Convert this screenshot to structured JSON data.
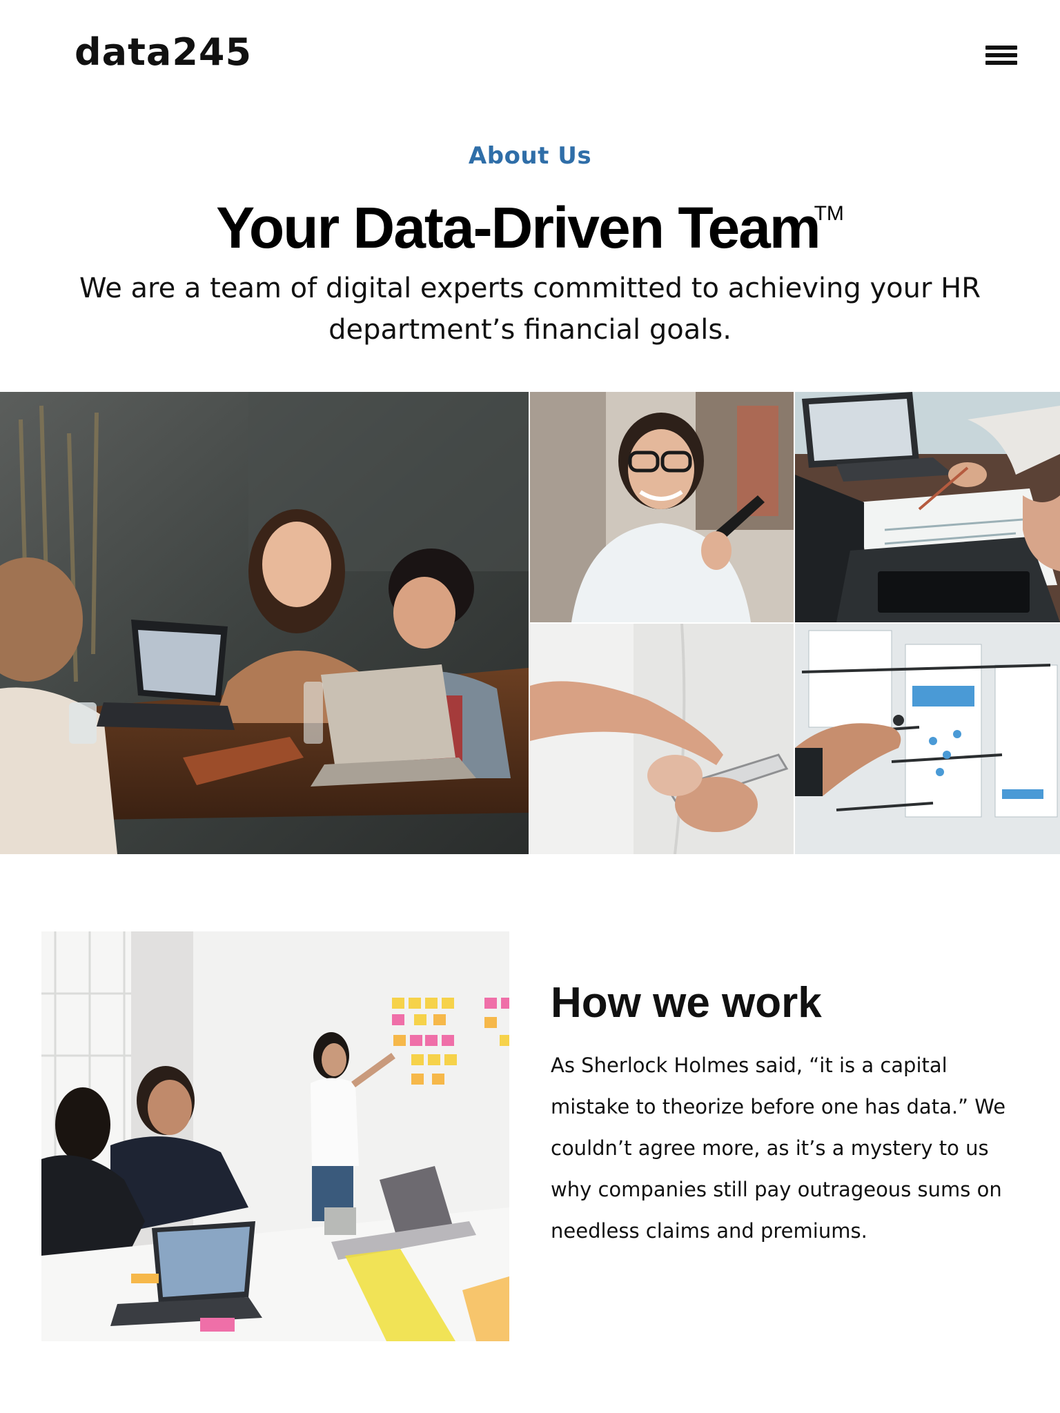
{
  "header": {
    "logo": "data245",
    "menu_icon": "hamburger-menu-icon"
  },
  "hero": {
    "eyebrow": "About Us",
    "headline": "Your Data-Driven Team",
    "trademark": "TM",
    "subtext": "We are a team of digital experts committed to achieving your HR department’s financial goals."
  },
  "gallery": {
    "photos": [
      "team-laughing-photo",
      "woman-with-phone-photo",
      "laptops-notes-photo",
      "finger-on-phone-photo",
      "hand-on-whiteboard-photo"
    ]
  },
  "how_we_work": {
    "title": "How we work",
    "body": "As Sherlock Holmes said, “it is a capital mistake to theorize before one has data.” We couldn’t agree more, as it’s a mystery to us why companies still pay outrageous sums on needless claims and premiums.",
    "photo": "team-meeting-sticky-notes-photo"
  },
  "colors": {
    "accent": "#2f6ea8",
    "text": "#111111",
    "background": "#ffffff"
  }
}
